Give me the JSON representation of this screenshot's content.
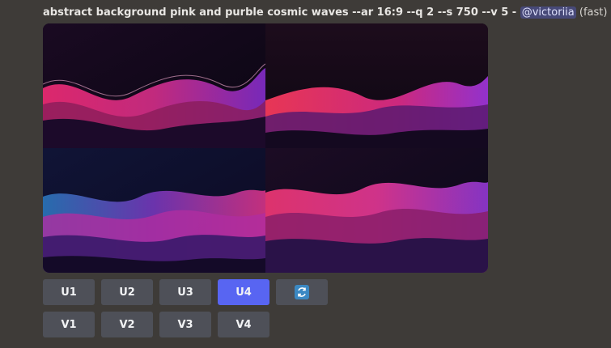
{
  "message": {
    "prompt": "abstract background pink and purble cosmic waves --ar 16:9 --q 2 --s 750 --v 5",
    "separator": " - ",
    "mention": "@victoriia",
    "speed": "(fast)"
  },
  "upscale_buttons": [
    {
      "label": "U1",
      "active": false
    },
    {
      "label": "U2",
      "active": false
    },
    {
      "label": "U3",
      "active": false
    },
    {
      "label": "U4",
      "active": true
    }
  ],
  "variation_buttons": [
    {
      "label": "V1"
    },
    {
      "label": "V2"
    },
    {
      "label": "V3"
    },
    {
      "label": "V4"
    }
  ],
  "icons": {
    "reroll": "reroll-icon"
  },
  "colors": {
    "active_button": "#5865f2",
    "button": "#4e5058",
    "reroll_icon": "#3b88c3"
  }
}
